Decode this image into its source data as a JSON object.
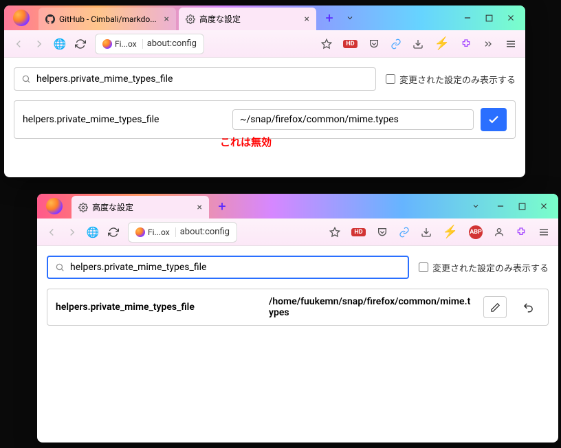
{
  "window1": {
    "tabs": [
      {
        "title": "GitHub - Cimbali/markdo...",
        "active": false
      },
      {
        "title": "高度な設定",
        "active": true
      }
    ],
    "address": {
      "identity": "Fi...ox",
      "url": "about:config"
    },
    "toolbar_badges": {
      "hd": "HD"
    },
    "search": {
      "value": "helpers.private_mime_types_file",
      "modified_only_label": "変更された設定のみ表示する"
    },
    "pref": {
      "name": "helpers.private_mime_types_file",
      "value": "~/snap/firefox/common/mime.types"
    }
  },
  "annotation1": "これは無効",
  "window2": {
    "tabs": [
      {
        "title": "高度な設定",
        "active": true
      }
    ],
    "address": {
      "identity": "Fi...ox",
      "url": "about:config"
    },
    "toolbar_badges": {
      "hd": "HD",
      "abp": "ABP"
    },
    "search": {
      "value": "helpers.private_mime_types_file",
      "modified_only_label": "変更された設定のみ表示する"
    },
    "pref": {
      "name": "helpers.private_mime_types_file",
      "value": "/home/fuukemn/snap/firefox/common/mime.types"
    }
  }
}
